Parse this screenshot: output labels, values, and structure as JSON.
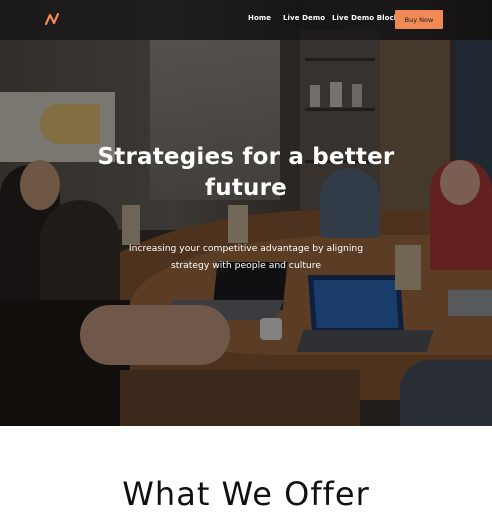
{
  "nav": {
    "logo_icon": "n-logo-icon",
    "links": [
      "Home",
      "Live Demo",
      "Live Demo Block"
    ],
    "buy_label": "Buy Now",
    "accent": "#f08a55"
  },
  "hero": {
    "title": "Strategies for a better future",
    "subtitle": "Increasing your competitive advantage by aligning strategy with people and culture"
  },
  "offer": {
    "title": "What We Offer"
  }
}
